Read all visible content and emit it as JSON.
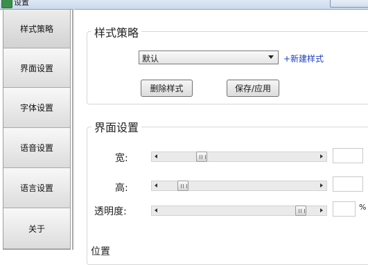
{
  "window": {
    "title": "设置"
  },
  "sidebar": {
    "items": [
      {
        "label": "样式策略"
      },
      {
        "label": "界面设置"
      },
      {
        "label": "字体设置"
      },
      {
        "label": "语音设置"
      },
      {
        "label": "语言设置"
      },
      {
        "label": "关于"
      }
    ]
  },
  "style_strategy": {
    "title": "样式策略",
    "selected_style": "默认",
    "new_style_link": "+新建样式",
    "delete_button": "删除样式",
    "save_button": "保存/应用"
  },
  "ui_settings": {
    "title": "界面设置",
    "width_label": "宽:",
    "width_value": "",
    "width_slider_fraction": 0.24,
    "height_label": "高:",
    "height_value": "",
    "height_slider_fraction": 0.11,
    "opacity_label": "透明度:",
    "opacity_value": "",
    "opacity_slider_fraction": 0.93,
    "percent_sign": "%"
  },
  "position_section": {
    "title": "位置"
  }
}
